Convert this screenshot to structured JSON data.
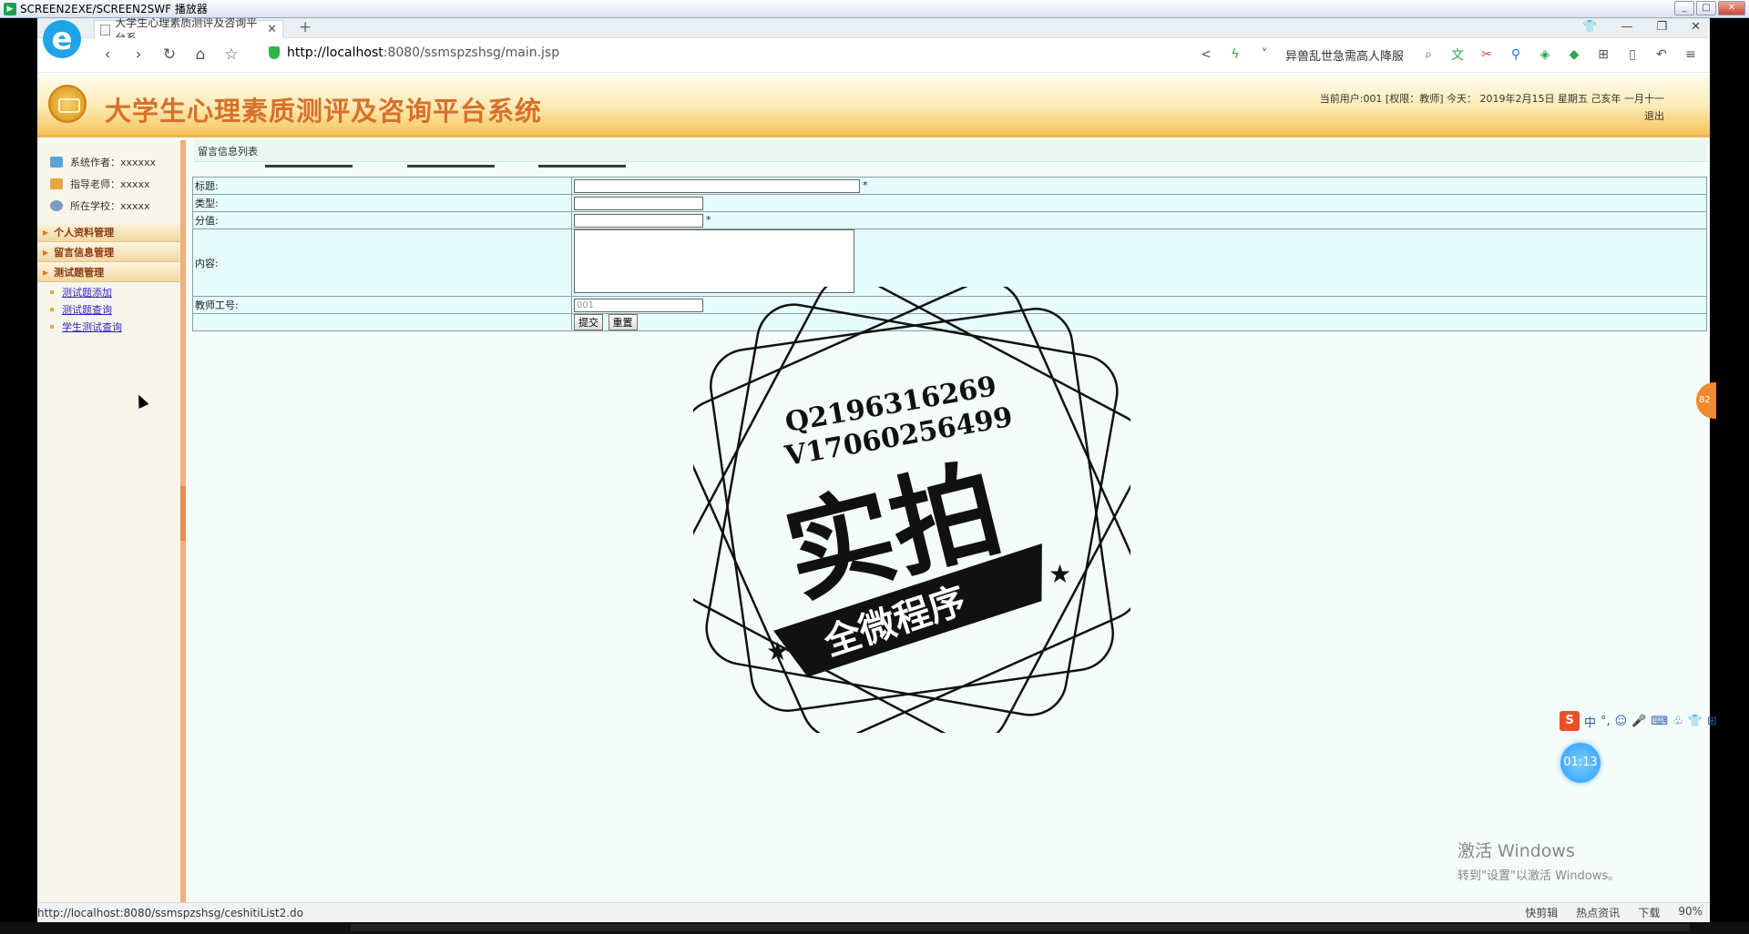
{
  "player": {
    "title": "SCREEN2EXE/SCREEN2SWF 播放器",
    "min": "_",
    "max": "□",
    "close": "✕"
  },
  "browser": {
    "logo_letter": "e",
    "tab_title": "大学生心理素质测评及咨询平台系",
    "tab_close": "✕",
    "new_tab": "+",
    "window_controls": {
      "shirt": "👕",
      "min": "—",
      "restore": "❐",
      "close": "✕"
    },
    "nav": {
      "back": "‹",
      "forward": "›",
      "reload": "↻",
      "home": "⌂",
      "star": "☆"
    },
    "url_host": "http://localhost",
    "url_rest": ":8080/ssmspzshsg/main.jsp",
    "search_hint": "异兽乱世急需高人降服",
    "right_icons": [
      "share-icon",
      "bolt-icon",
      "chevron-icon",
      "search-icon",
      "translate-icon",
      "scissors-icon",
      "magnifier-icon",
      "gamepad-icon",
      "shield-icon",
      "apps-icon",
      "reader-icon",
      "undo-icon",
      "menu-icon"
    ],
    "right_glyphs": {
      "share": "<",
      "bolt": "ϟ",
      "chevron": "˅",
      "search": "⌕",
      "translate": "文",
      "scissors": "✂",
      "magnifier": "⚲",
      "gamepad": "◈",
      "shield": "◆",
      "apps": "⊞",
      "reader": "▯",
      "undo": "↶",
      "menu": "≡"
    }
  },
  "banner": {
    "title": "大学生心理素质测评及咨询平台系统",
    "user_info": "当前用户:001 [权限：教师] 今天：  2019年2月15日 星期五 己亥年 一月十一",
    "logout": "退出"
  },
  "sidebar": {
    "info": [
      {
        "label": "系统作者：xxxxxx",
        "color": "#5ba3d8"
      },
      {
        "label": "指导老师：xxxxx",
        "color": "#e8a443"
      },
      {
        "label": "所在学校：xxxxx",
        "color": "#7d9ec2"
      }
    ],
    "menus": [
      {
        "label": "个人资料管理"
      },
      {
        "label": "留言信息管理"
      },
      {
        "label": "测试题管理"
      }
    ],
    "sub_items": [
      {
        "label": "测试题添加"
      },
      {
        "label": "测试题查询"
      },
      {
        "label": "学生测试查询"
      }
    ]
  },
  "main": {
    "list_title": "留言信息列表",
    "form": {
      "title_label": "标题:",
      "type_label": "类型:",
      "score_label": "分值:",
      "content_label": "内容:",
      "teacher_label": "教师工号:",
      "teacher_value": "001",
      "required_mark": "*",
      "submit": "提交",
      "reset": "重置"
    }
  },
  "watermark": {
    "line1": "Q2196316269",
    "line2": "V17060256499",
    "big": "实拍",
    "ribbon": "全微程序"
  },
  "overlays": {
    "timer": "01:13",
    "ime": [
      "中",
      "°,",
      "☺",
      "🎤",
      "⌨",
      "♧",
      "👕",
      "⊞"
    ],
    "ime_logo": "S",
    "side_badge": "82",
    "activate_big": "激活 Windows",
    "activate_small": "转到\"设置\"以激活 Windows。"
  },
  "status": {
    "url": "http://localhost:8080/ssmspzshsg/ceshitiList2.do",
    "items": [
      "快剪辑",
      "热点资讯",
      "下载",
      "90%"
    ]
  },
  "colors": {
    "banner_title": "#d6712c",
    "sidebar_edge": "#f1ae7f",
    "form_bg": "#e6fbfb",
    "link": "#3524b8"
  }
}
